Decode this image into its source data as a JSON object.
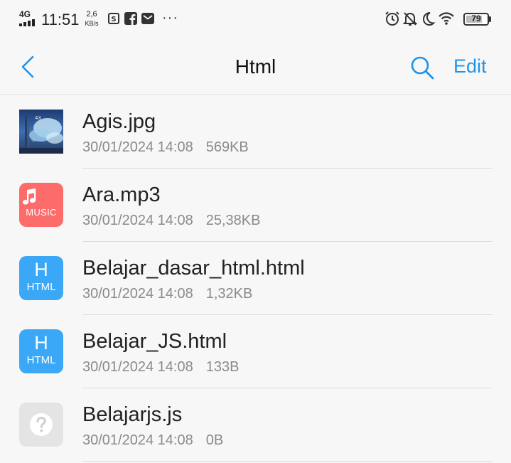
{
  "status_bar": {
    "network": "4G",
    "time": "11:51",
    "speed_value": "2,6",
    "speed_unit": "KB/s",
    "notification_icons": [
      "screenshot-icon",
      "facebook-icon",
      "mail-icon"
    ],
    "overflow": "···",
    "right_icons": [
      "alarm-icon",
      "notifications-muted-icon",
      "do-not-disturb-moon-icon",
      "wifi-icon"
    ],
    "battery_percent": "79",
    "battery_level": 0.79
  },
  "header": {
    "title": "Html",
    "edit_label": "Edit",
    "accent_color": "#1f94e8"
  },
  "files": [
    {
      "name": "Agis.jpg",
      "date": "30/01/2024 14:08",
      "size": "569KB",
      "icon": "image-thumbnail"
    },
    {
      "name": "Ara.mp3",
      "date": "30/01/2024 14:08",
      "size": "25,38KB",
      "icon": "music-file-icon",
      "icon_label": "MUSIC",
      "icon_color": "#fd6b6b"
    },
    {
      "name": "Belajar_dasar_html.html",
      "date": "30/01/2024 14:08",
      "size": "1,32KB",
      "icon": "html-file-icon",
      "icon_letter": "H",
      "icon_label": "HTML",
      "icon_color": "#3aa8f6"
    },
    {
      "name": "Belajar_JS.html",
      "date": "30/01/2024 14:08",
      "size": "133B",
      "icon": "html-file-icon",
      "icon_letter": "H",
      "icon_label": "HTML",
      "icon_color": "#3aa8f6"
    },
    {
      "name": "Belajarjs.js",
      "date": "30/01/2024 14:08",
      "size": "0B",
      "icon": "unknown-file-icon"
    }
  ]
}
